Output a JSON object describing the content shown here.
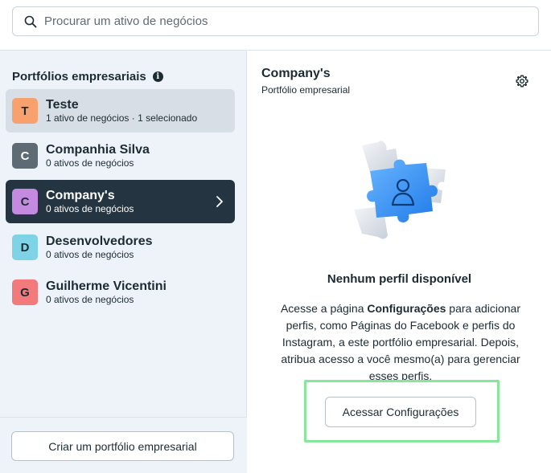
{
  "search": {
    "placeholder": "Procurar um ativo de negócios"
  },
  "sidebar": {
    "title": "Portfólios empresariais",
    "items": [
      {
        "initial": "T",
        "name": "Teste",
        "subtitle": "1 ativo de negócios · 1 selecionado",
        "avatar_bg": "#f7a26e",
        "avatar_fg": "#1c2b33"
      },
      {
        "initial": "C",
        "name": "Companhia Silva",
        "subtitle": "0 ativos de negócios",
        "avatar_bg": "#5f6b74",
        "avatar_fg": "#ffffff"
      },
      {
        "initial": "C",
        "name": "Company's",
        "subtitle": "0 ativos de negócios",
        "avatar_bg": "#c38ae0",
        "avatar_fg": "#1c2b33"
      },
      {
        "initial": "D",
        "name": "Desenvolvedores",
        "subtitle": "0 ativos de negócios",
        "avatar_bg": "#7fd3e6",
        "avatar_fg": "#1c2b33"
      },
      {
        "initial": "G",
        "name": "Guilherme Vicentini",
        "subtitle": "0 ativos de negócios",
        "avatar_bg": "#f2797c",
        "avatar_fg": "#1c2b33"
      }
    ],
    "create_label": "Criar um portfólio empresarial"
  },
  "detail": {
    "title": "Company's",
    "subtitle": "Portfólio empresarial",
    "empty_title": "Nenhum perfil disponível",
    "desc_before": "Acesse a página ",
    "desc_bold": "Configurações",
    "desc_after": " para adicionar perfis, como Páginas do Facebook e perfis do Instagram, a este portfólio empresarial. Depois, atribua acesso a você mesmo(a) para gerenciar esses perfis.",
    "settings_label": "Acessar Configurações"
  },
  "colors": {
    "selected_bg": "#243541",
    "hover_bg": "#d7dee6",
    "panel_bg": "#eef3fa",
    "highlight": "#86e79b",
    "puzzle_blue": "#2a8cf2"
  },
  "icons": [
    "search-icon",
    "info-icon",
    "chevron-right-icon",
    "gear-icon",
    "puzzle-user-illustration"
  ]
}
